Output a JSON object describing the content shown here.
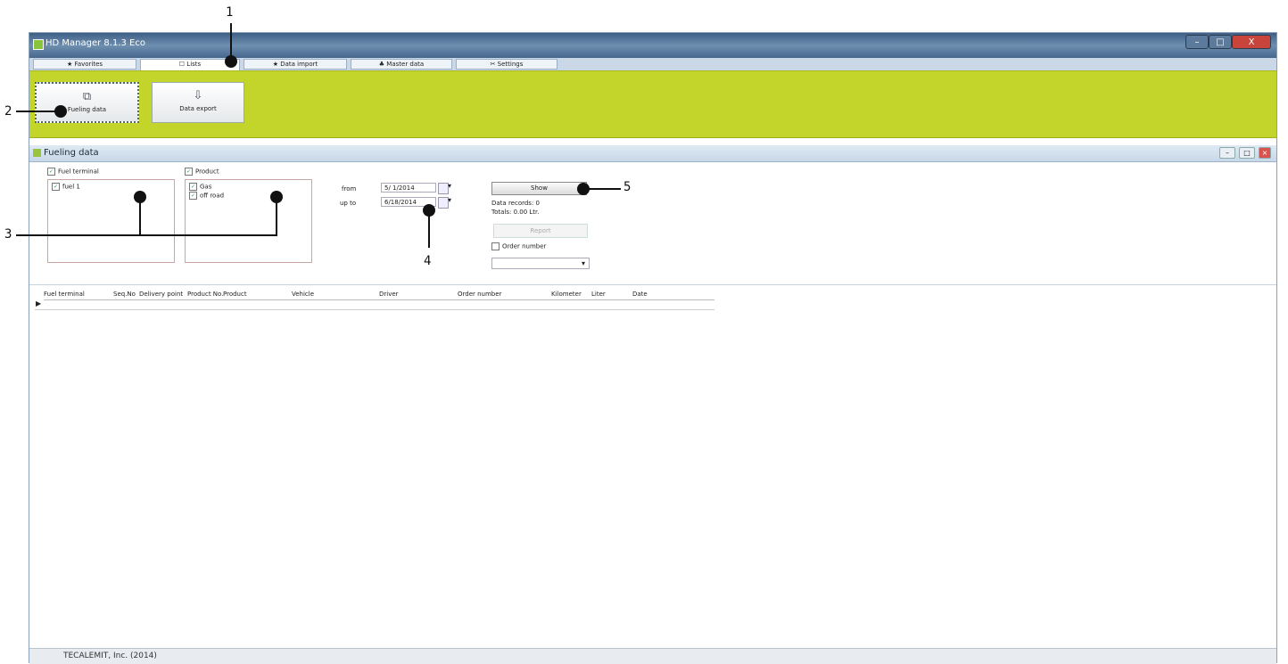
{
  "window": {
    "title": "HD Manager 8.1.3 Eco",
    "controls": [
      "–",
      "□",
      "X"
    ]
  },
  "tabs": [
    {
      "label": "★ Favorites"
    },
    {
      "label": "☐ Lists"
    },
    {
      "label": "★ Data import"
    },
    {
      "label": "♣ Master data"
    },
    {
      "label": "✂ Settings"
    }
  ],
  "ribbon": {
    "buttons": [
      {
        "label": "Fueling data",
        "icon": "fueling-data-icon"
      },
      {
        "label": "Data export",
        "icon": "data-export-icon"
      }
    ]
  },
  "panel": {
    "title": "Fueling data",
    "fuel_terminal": {
      "header": "Fuel terminal",
      "items": [
        "fuel 1"
      ]
    },
    "product": {
      "header": "Product",
      "items": [
        "Gas",
        "off road"
      ]
    },
    "from_label": "from",
    "from_value": "5/ 1/2014",
    "upto_label": "up to",
    "upto_value": "6/18/2014",
    "show_button": "Show",
    "data_records": "Data records: 0",
    "totals": "Totals: 0.00 Ltr.",
    "report_button": "Report",
    "order_number_label": "Order number"
  },
  "grid": {
    "columns": [
      "Fuel terminal",
      "Seq.No",
      "Delivery point",
      "Product No.",
      "Product",
      "Vehicle",
      "Driver",
      "Order number",
      "Kilometer",
      "Liter",
      "Date"
    ]
  },
  "status": {
    "text": "TECALEMIT, Inc. (2014)"
  },
  "callouts": [
    "1",
    "2",
    "3",
    "4",
    "5"
  ]
}
